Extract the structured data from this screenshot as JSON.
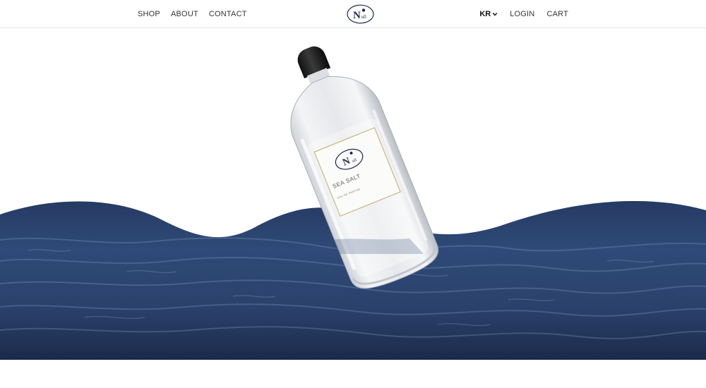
{
  "nav": {
    "left": [
      {
        "label": "SHOP"
      },
      {
        "label": "ABOUT"
      },
      {
        "label": "CONTACT"
      }
    ],
    "language": {
      "selected": "KR",
      "icon": "chevron-down-icon"
    },
    "login_label": "LOGIN",
    "cart_label": "CART"
  },
  "logo": {
    "letters": "N",
    "sub": "ull"
  },
  "product": {
    "label_name": "SEA SALT",
    "label_sub": "EAU DE PARFUM"
  },
  "colors": {
    "ocean_dark": "#1b2a4a",
    "ocean_mid": "#2f4a78",
    "ocean_light": "#6d84ad",
    "brand": "#1f2a4f",
    "label_gold": "#c9b77a"
  }
}
